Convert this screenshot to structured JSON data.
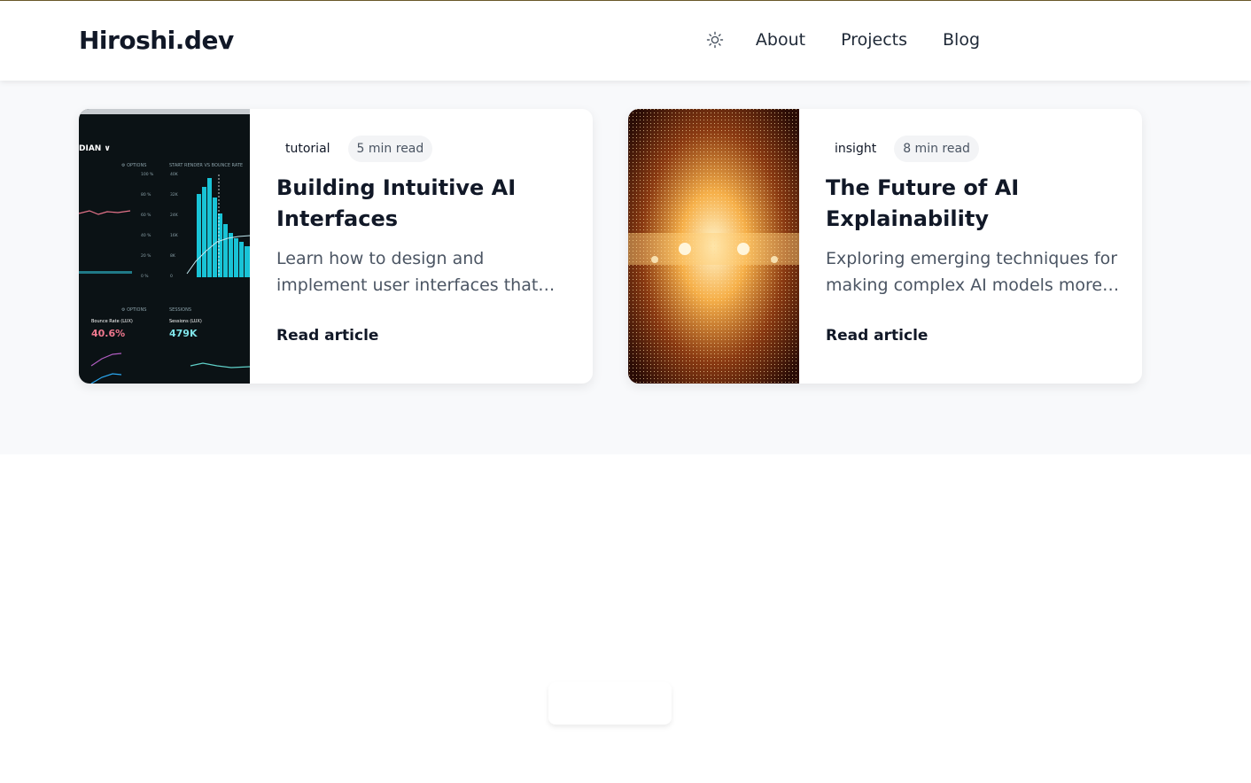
{
  "site": {
    "logo": "Hiroshi.dev"
  },
  "nav": {
    "items": [
      "About",
      "Projects",
      "Blog"
    ],
    "theme_icon": "sun-icon"
  },
  "articles": [
    {
      "tag": "tutorial",
      "read_time": "5 min read",
      "title": "Building Intuitive AI Interfaces",
      "excerpt": "Learn how to design and implement user interfaces that make AI systems more approachable",
      "cta": "Read article",
      "image": "analytics-dashboard-photo"
    },
    {
      "tag": "insight",
      "read_time": "8 min read",
      "title": "The Future of AI Explainability",
      "excerpt": "Exploring emerging techniques for making complex AI models more transparent",
      "cta": "Read article",
      "image": "light-particles-photo"
    }
  ],
  "colors": {
    "text": "#111827",
    "muted": "#4b5563",
    "page_bg": "#f8f9fb"
  }
}
